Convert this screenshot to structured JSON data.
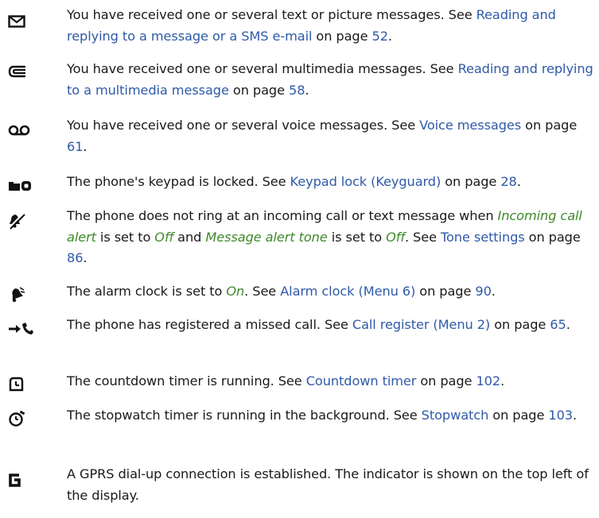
{
  "entries": [
    {
      "icon": "envelope-icon",
      "t1": "You have received one or several text or picture messages. See ",
      "link1": "Reading and replying to a message or a SMS e-mail",
      "t2": " on page ",
      "page": "52",
      "t3": "."
    },
    {
      "icon": "multimedia-message-icon",
      "t1": "You have received one or several multimedia messages. See ",
      "link1": "Reading and replying to a multimedia message",
      "t2": " on page ",
      "page": "58",
      "t3": "."
    },
    {
      "icon": "voice-message-icon",
      "t1": "You have received one or several voice messages. See ",
      "link1": "Voice messages",
      "t2": " on page ",
      "page": "61",
      "t3": "."
    },
    {
      "icon": "key-lock-icon",
      "t1": "The phone's keypad is locked. See ",
      "link1": "Keypad lock (Keyguard)",
      "t2": " on page ",
      "page": "28",
      "t3": "."
    },
    {
      "icon": "silent-icon",
      "t1": "The phone does not ring at an incoming call or text message when ",
      "em1": "Incoming call alert",
      "t1b": " is set to ",
      "em2": "Off",
      "t1c": " and ",
      "em3": "Message alert tone",
      "t1d": " is set to ",
      "em4": "Off",
      "t1e": ". See ",
      "link1": "Tone settings",
      "t2": " on page ",
      "page": "86",
      "t3": "."
    },
    {
      "icon": "alarm-clock-icon",
      "t1": "The alarm clock is set to ",
      "em1": "On",
      "t1b": ". See ",
      "link1": "Alarm clock (Menu 6)",
      "t2": " on page ",
      "page": "90",
      "t3": "."
    },
    {
      "icon": "missed-call-icon",
      "t1": "The phone has registered a missed call. See ",
      "link1": "Call register (Menu 2)",
      "t2": " on page ",
      "page": "65",
      "t3": "."
    },
    {
      "icon": "countdown-timer-icon",
      "t1": "The countdown timer is running. See ",
      "link1": "Countdown timer",
      "t2": " on page ",
      "page": "102",
      "t3": "."
    },
    {
      "icon": "stopwatch-icon",
      "t1": "The stopwatch timer is running in the background. See ",
      "link1": "Stopwatch",
      "t2": " on page ",
      "page": "103",
      "t3": "."
    },
    {
      "icon": "gprs-icon",
      "t1": "A GPRS dial-up connection is established. The indicator is shown on the top left of the display."
    }
  ],
  "colors": {
    "link": "#2f5aa8",
    "emphasis": "#3e8a2a",
    "text": "#1a1a1a"
  }
}
